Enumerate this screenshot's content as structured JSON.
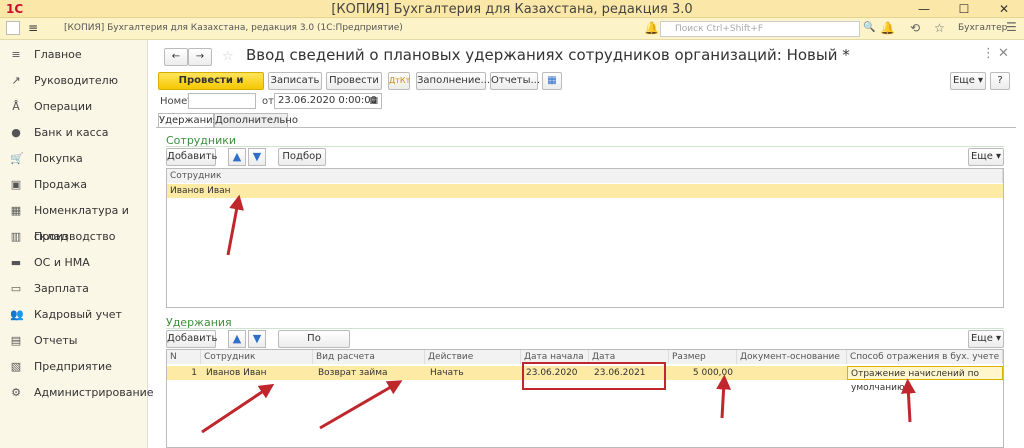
{
  "window": {
    "title": "[КОПИЯ] Бухгалтерия для Казахстана, редакция 3.0",
    "subtitle": "[КОПИЯ] Бухгалтерия для Казахстана, редакция 3.0  (1С:Предприятие)",
    "logo": "1С",
    "search_placeholder": "Поиск Ctrl+Shift+F",
    "user": "Бухгалтер"
  },
  "sidebar": {
    "items": [
      {
        "label": "Главное",
        "icon": "menu-icon"
      },
      {
        "label": "Руководителю",
        "icon": "chart-icon"
      },
      {
        "label": "Операции",
        "icon": "operations-icon"
      },
      {
        "label": "Банк и касса",
        "icon": "bank-icon"
      },
      {
        "label": "Покупка",
        "icon": "cart-icon"
      },
      {
        "label": "Продажа",
        "icon": "bag-icon"
      },
      {
        "label": "Номенклатура и склад",
        "icon": "grid-icon"
      },
      {
        "label": "Производство",
        "icon": "factory-icon"
      },
      {
        "label": "ОС и НМА",
        "icon": "truck-icon"
      },
      {
        "label": "Зарплата",
        "icon": "money-icon"
      },
      {
        "label": "Кадровый учет",
        "icon": "people-icon"
      },
      {
        "label": "Отчеты",
        "icon": "reports-icon"
      },
      {
        "label": "Предприятие",
        "icon": "building-icon"
      },
      {
        "label": "Администрирование",
        "icon": "gear-icon"
      }
    ]
  },
  "form": {
    "title": "Ввод сведений о плановых удержаниях сотрудников организаций: Новый *",
    "buttons": {
      "post_close": "Провести и закрыть",
      "save": "Записать",
      "post": "Провести",
      "fill": "Заполнение...",
      "reports": "Отчеты...",
      "more": "Еще",
      "help": "?"
    },
    "number_label": "Номер:",
    "number_value": "",
    "date_label": "от:",
    "date_value": "23.06.2020  0:00:00",
    "tabs": [
      "Удержания",
      "Дополнительно"
    ]
  },
  "employees": {
    "title": "Сотрудники",
    "add": "Добавить",
    "pick": "Подбор",
    "more": "Еще",
    "header": "Сотрудник",
    "rows": [
      "Иванов Иван"
    ]
  },
  "deductions": {
    "title": "Удержания",
    "add": "Добавить",
    "by_employee": "По сотруднику",
    "more": "Еще",
    "headers": [
      "N",
      "Сотрудник",
      "Вид расчета",
      "Действие",
      "Дата начала",
      "Дата окончания",
      "Размер",
      "Документ-основание",
      "Способ отражения в бух. учете"
    ],
    "rows": [
      {
        "n": "1",
        "employee": "Иванов Иван",
        "calc_type": "Возврат займа",
        "action": "Начать",
        "start": "23.06.2020",
        "end": "23.06.2021",
        "amount": "5 000,00",
        "basis": "",
        "reflection": "Отражение начислений по умолчанию"
      }
    ]
  }
}
